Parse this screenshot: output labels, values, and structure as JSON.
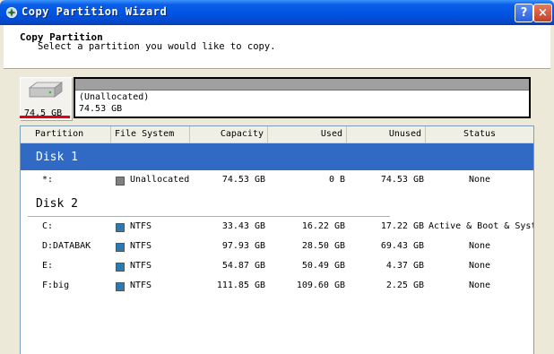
{
  "window": {
    "title": "Copy Partition Wizard",
    "help_label": "?",
    "close_label": "×"
  },
  "header": {
    "title": "Copy Partition",
    "subtitle": "Select a partition you would like to copy."
  },
  "disk_map": {
    "disk_size": "74.5 GB",
    "partition_label": "(Unallocated)",
    "partition_size": "74.53 GB"
  },
  "columns": [
    "Partition",
    "File System",
    "Capacity",
    "Used",
    "Unused",
    "Status"
  ],
  "groups": [
    {
      "name": "Disk 1",
      "selected": true,
      "rows": [
        {
          "partition": "*:",
          "fs": "Unallocated",
          "fs_color": "#808080",
          "capacity": "74.53 GB",
          "used": "0 B",
          "unused": "74.53 GB",
          "status": "None"
        }
      ]
    },
    {
      "name": "Disk 2",
      "selected": false,
      "rows": [
        {
          "partition": "C:",
          "fs": "NTFS",
          "fs_color": "#2a7ab4",
          "capacity": "33.43 GB",
          "used": "16.22 GB",
          "unused": "17.22 GB",
          "status": "Active & Boot & System"
        },
        {
          "partition": "D:DATABAK",
          "fs": "NTFS",
          "fs_color": "#2a7ab4",
          "capacity": "97.93 GB",
          "used": "28.50 GB",
          "unused": "69.43 GB",
          "status": "None"
        },
        {
          "partition": "E:",
          "fs": "NTFS",
          "fs_color": "#2a7ab4",
          "capacity": "54.87 GB",
          "used": "50.49 GB",
          "unused": "4.37 GB",
          "status": "None"
        },
        {
          "partition": "F:big",
          "fs": "NTFS",
          "fs_color": "#2a7ab4",
          "capacity": "111.85 GB",
          "used": "109.60 GB",
          "unused": "2.25 GB",
          "status": "None"
        }
      ]
    }
  ],
  "colors": {
    "title_bar": "#0054e3",
    "selection": "#316ac5",
    "disk_underline": "#e0001b",
    "unallocated": "#808080",
    "ntfs": "#2a7ab4"
  }
}
